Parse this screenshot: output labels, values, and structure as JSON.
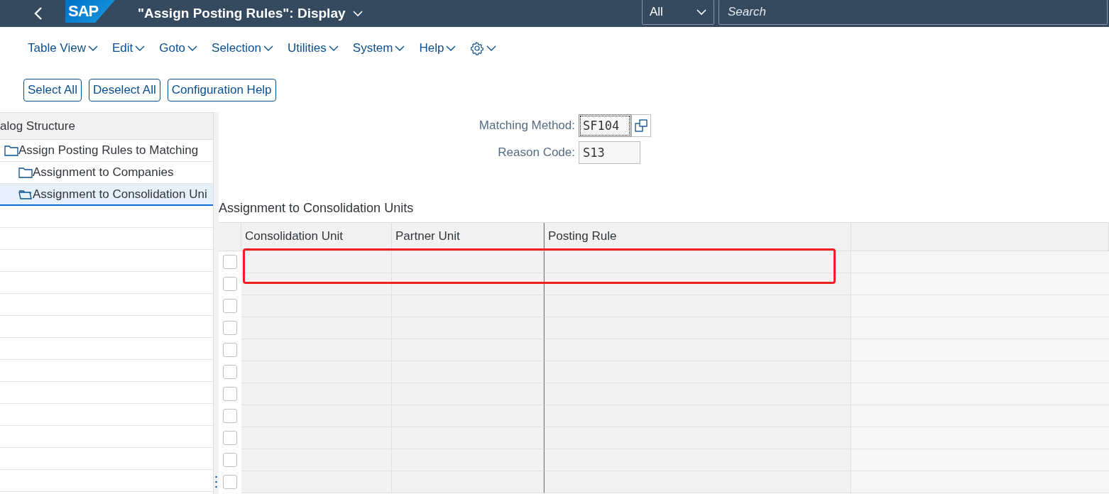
{
  "shell_bar": {
    "title": "\"Assign Posting Rules\": Display",
    "logo": "SAP",
    "scope": "All",
    "search": {
      "placeholder": "Search"
    }
  },
  "menu": [
    "Table View",
    "Edit",
    "Goto",
    "Selection",
    "Utilities",
    "System",
    "Help"
  ],
  "toolbar": [
    "Select All",
    "Deselect All",
    "Configuration Help"
  ],
  "dialog_structure": {
    "title": "alog Structure",
    "items": [
      {
        "label": "Assign Posting Rules to Matching",
        "selected": false,
        "children": [
          {
            "label": "Assignment to Companies",
            "selected": false
          },
          {
            "label": "Assignment to Consolidation Uni",
            "selected": true
          }
        ]
      }
    ]
  },
  "fields": [
    {
      "label": "Matching Method:",
      "value": "SF104",
      "focused": true,
      "value_help": true
    },
    {
      "label": "Reason Code:",
      "value": "S13",
      "focused": false
    }
  ],
  "table": {
    "title": "Assignment to Consolidation Units",
    "columns": [
      "Consolidation Unit",
      "Partner Unit",
      "Posting Rule"
    ],
    "rows": [
      {
        "selected": false,
        "highlighted": true
      },
      {
        "selected": false,
        "highlighted": false
      },
      {
        "selected": false,
        "highlighted": false
      },
      {
        "selected": false,
        "highlighted": false
      },
      {
        "selected": false,
        "highlighted": false
      },
      {
        "selected": false,
        "highlighted": false
      },
      {
        "selected": false,
        "highlighted": false
      },
      {
        "selected": false,
        "highlighted": false
      },
      {
        "selected": false,
        "highlighted": false
      },
      {
        "selected": false,
        "highlighted": false
      },
      {
        "selected": false,
        "highlighted": false
      }
    ]
  }
}
